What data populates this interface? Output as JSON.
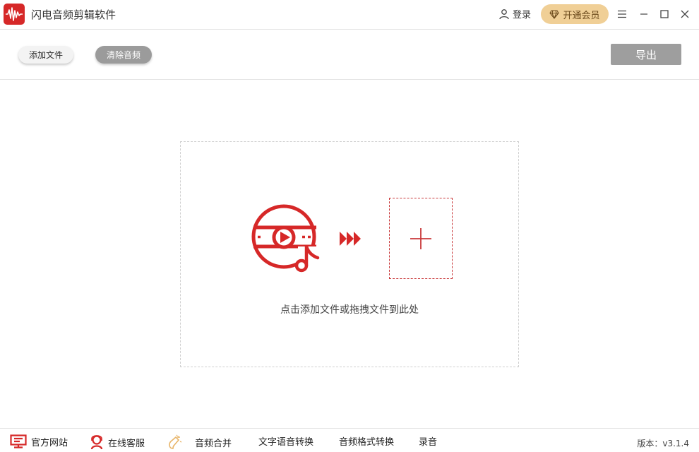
{
  "title_bar": {
    "app_title": "闪电音频剪辑软件",
    "login_label": "登录",
    "vip_label": "开通会员"
  },
  "toolbar": {
    "add_file_label": "添加文件",
    "clear_audio_label": "清除音频",
    "export_label": "导出"
  },
  "dropzone": {
    "hint": "点击添加文件或拖拽文件到此处"
  },
  "bottom_bar": {
    "items": [
      {
        "label": "官方网站",
        "icon": "monitor-icon"
      },
      {
        "label": "在线客服",
        "icon": "support-agent-icon"
      },
      {
        "label": "音频合并",
        "icon": "sparkle-icon"
      },
      {
        "label": "文字语音转换"
      },
      {
        "label": "音频格式转换"
      },
      {
        "label": "录音"
      }
    ],
    "version": "版本：v3.1.4"
  },
  "colors": {
    "accent_red": "#d62828",
    "vip_gold": "#f0cf96",
    "button_gray": "#9e9e9e"
  }
}
